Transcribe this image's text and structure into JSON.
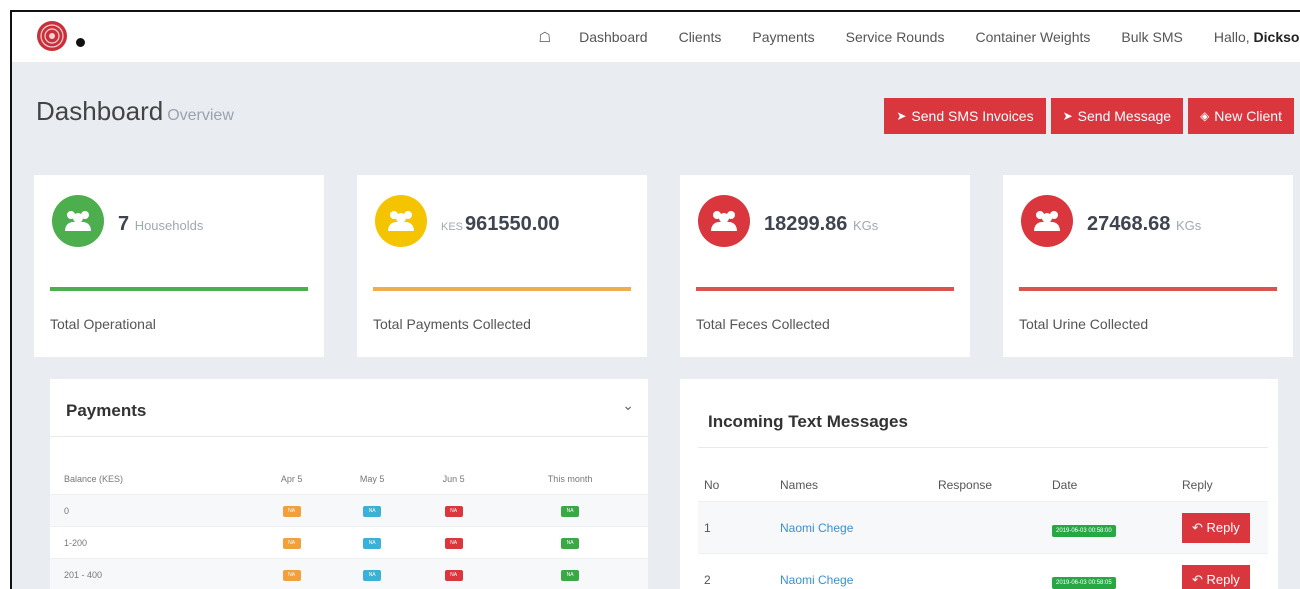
{
  "nav": {
    "items": [
      "Dashboard",
      "Clients",
      "Payments",
      "Service Rounds",
      "Container Weights",
      "Bulk SMS"
    ],
    "hello": "Hallo,",
    "user": "Dickson"
  },
  "header": {
    "title": "Dashboard",
    "subtitle": "Overview",
    "buttons": {
      "sms_invoices": "Send SMS Invoices",
      "send_message": "Send Message",
      "new_client": "New Client"
    }
  },
  "stats": [
    {
      "prefix": "",
      "value": "7",
      "unit": "Households",
      "label": "Total Operational",
      "color": "#4cae4c"
    },
    {
      "prefix": "KES",
      "value": "961550.00",
      "unit": "",
      "label": "Total Payments Collected",
      "color": "#f0ad4e"
    },
    {
      "prefix": "",
      "value": "18299.86",
      "unit": "KGs",
      "label": "Total Feces Collected",
      "color": "#d9363e"
    },
    {
      "prefix": "",
      "value": "27468.68",
      "unit": "KGs",
      "label": "Total Urine Collected",
      "color": "#d9363e"
    }
  ],
  "payments": {
    "title": "Payments",
    "headers": [
      "Balance (KES)",
      "Apr 5",
      "May 5",
      "Jun 5",
      "This month"
    ],
    "rows": [
      {
        "balance": "0",
        "badges": [
          "NA",
          "NA",
          "NA",
          "NA"
        ]
      },
      {
        "balance": "1-200",
        "badges": [
          "NA",
          "NA",
          "NA",
          "NA"
        ]
      },
      {
        "balance": "201 - 400",
        "badges": [
          "NA",
          "NA",
          "NA",
          "NA"
        ]
      }
    ],
    "badge_colors": [
      "#f0a03c",
      "#3cb0d6",
      "#d9363e",
      "#3aa845"
    ]
  },
  "messages": {
    "title": "Incoming Text Messages",
    "headers": [
      "No",
      "Names",
      "Response",
      "Date",
      "Reply"
    ],
    "rows": [
      {
        "no": "1",
        "name": "Naomi Chege",
        "response": "",
        "date": "2019-06-03 00:58:00",
        "reply": "Reply"
      },
      {
        "no": "2",
        "name": "Naomi Chege",
        "response": "",
        "date": "2019-06-03 00:58:05",
        "reply": "Reply"
      }
    ]
  }
}
